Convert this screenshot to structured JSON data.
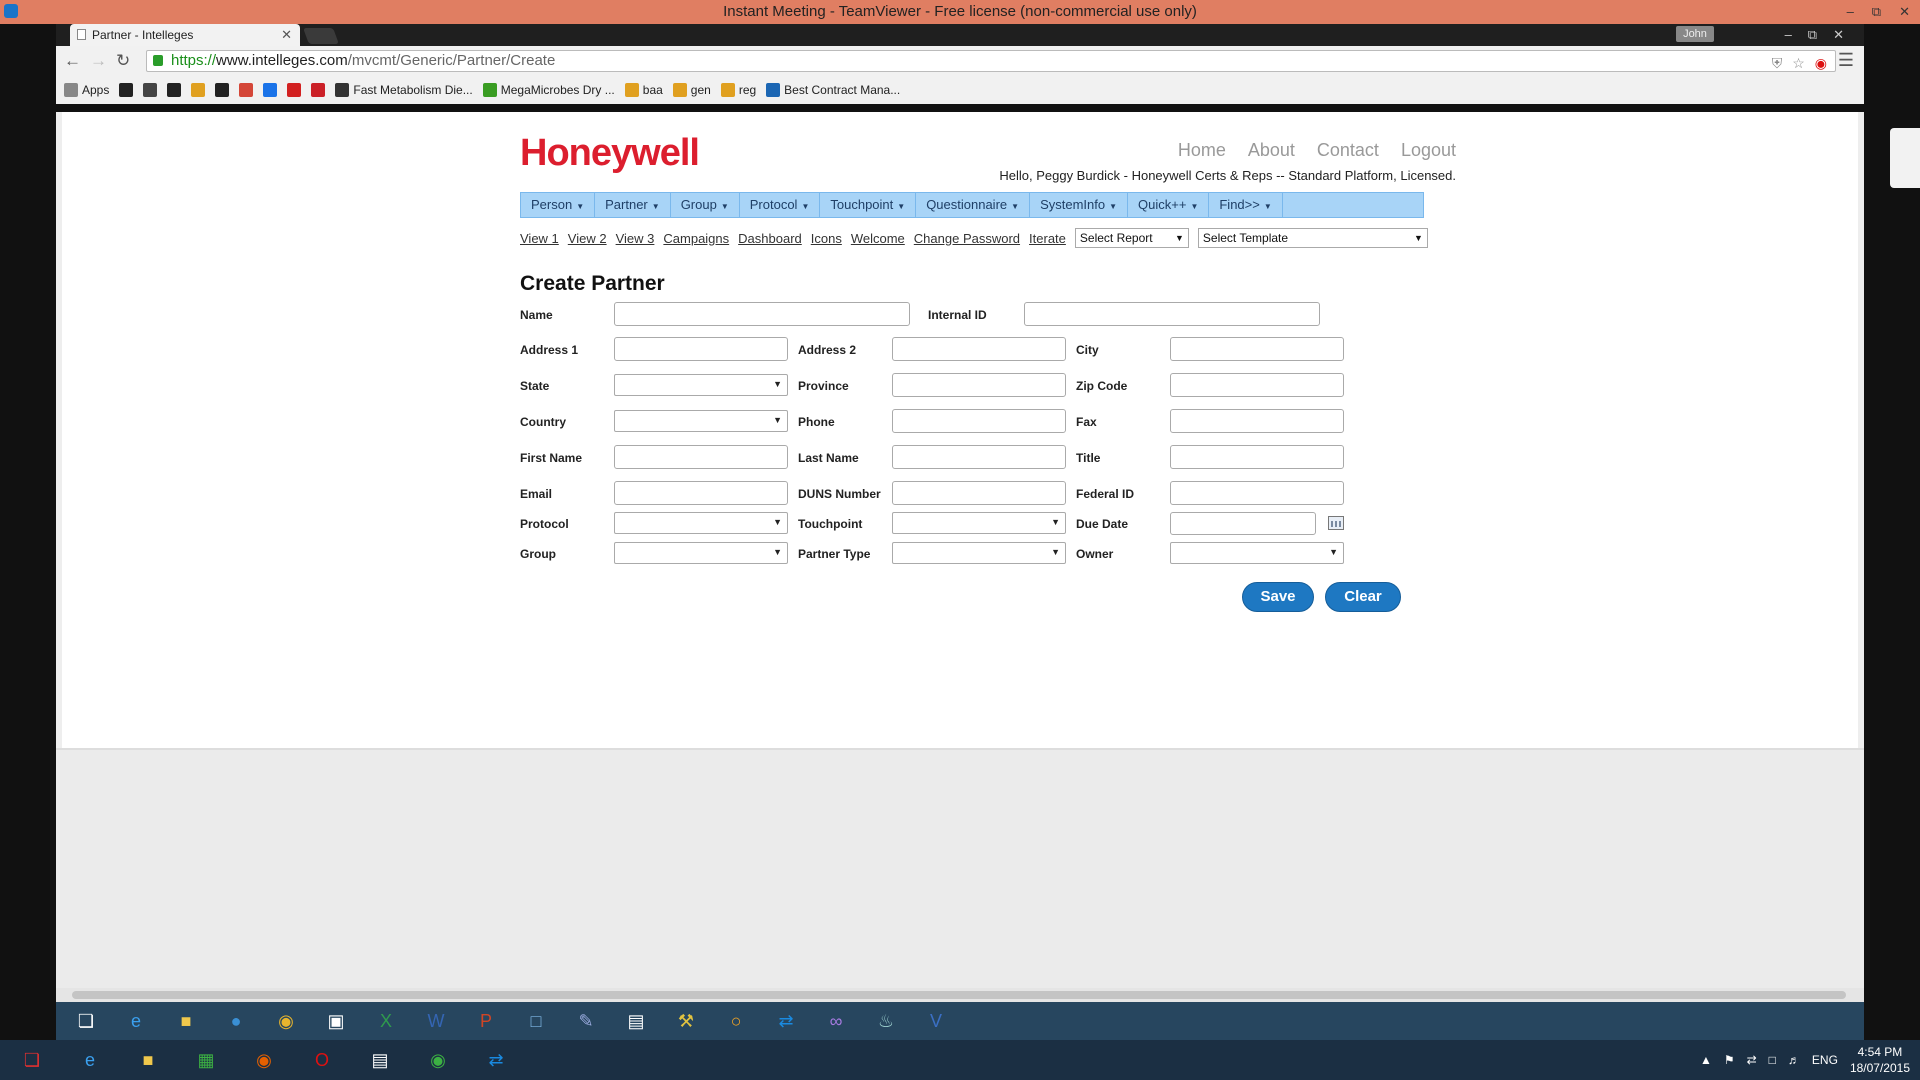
{
  "teamviewer": {
    "title": "Instant Meeting - TeamViewer - Free license (non-commercial use only)"
  },
  "browser": {
    "tab_title": "Partner - Intelleges",
    "profile": "John",
    "url_scheme": "https://",
    "url_host": "www.intelleges.com",
    "url_path": "/mvcmt/Generic/Partner/Create",
    "bookmarks": [
      {
        "label": "Apps",
        "icon": "apps-icon",
        "color": "#888888"
      },
      {
        "label": "",
        "icon": "nyt-icon",
        "color": "#222222"
      },
      {
        "label": "",
        "icon": "h-icon",
        "color": "#444444"
      },
      {
        "label": "",
        "icon": "wp-icon",
        "color": "#222222"
      },
      {
        "label": "",
        "icon": "bookmark-cluster-icon",
        "color": "#e0a020"
      },
      {
        "label": "",
        "icon": "amazon-icon",
        "color": "#222222"
      },
      {
        "label": "",
        "icon": "gmail-icon",
        "color": "#d44638"
      },
      {
        "label": "",
        "icon": "play-icon",
        "color": "#1a73e8"
      },
      {
        "label": "",
        "icon": "on-icon",
        "color": "#d22020"
      },
      {
        "label": "",
        "icon": "pinterest-icon",
        "color": "#cb2027"
      },
      {
        "label": "Fast Metabolism Die...",
        "icon": "leaf-icon",
        "color": "#333333"
      },
      {
        "label": "MegaMicrobes Dry ...",
        "icon": "f-icon",
        "color": "#3a9d23"
      },
      {
        "label": "baa",
        "icon": "bookmark-cluster-icon",
        "color": "#e0a020"
      },
      {
        "label": "gen",
        "icon": "bookmark-cluster-icon",
        "color": "#e0a020"
      },
      {
        "label": "reg",
        "icon": "bookmark-cluster-icon",
        "color": "#e0a020"
      },
      {
        "label": "Best Contract Mana...",
        "icon": "c-icon",
        "color": "#1b66b3"
      }
    ]
  },
  "site": {
    "logo": "Honeywell",
    "topnav": [
      "Home",
      "About",
      "Contact",
      "Logout"
    ],
    "greeting": "Hello, Peggy Burdick - Honeywell Certs & Reps -- Standard Platform, Licensed.",
    "menu": [
      "Person",
      "Partner",
      "Group",
      "Protocol",
      "Touchpoint",
      "Questionnaire",
      "SystemInfo",
      "Quick++",
      "Find>>"
    ],
    "subnav": [
      "View 1",
      "View 2",
      "View 3",
      "Campaigns",
      "Dashboard",
      "Icons",
      "Welcome",
      "Change Password",
      "Iterate"
    ],
    "select_report": "Select Report",
    "select_template": "Select Template"
  },
  "form": {
    "title": "Create Partner",
    "labels": {
      "name": "Name",
      "internal_id": "Internal ID",
      "address1": "Address 1",
      "address2": "Address 2",
      "city": "City",
      "state": "State",
      "province": "Province",
      "zip": "Zip Code",
      "country": "Country",
      "phone": "Phone",
      "fax": "Fax",
      "first_name": "First Name",
      "last_name": "Last Name",
      "title": "Title",
      "email": "Email",
      "duns": "DUNS Number",
      "federal_id": "Federal ID",
      "protocol": "Protocol",
      "touchpoint": "Touchpoint",
      "due_date": "Due Date",
      "group": "Group",
      "partner_type": "Partner Type",
      "owner": "Owner"
    },
    "save": "Save",
    "clear": "Clear"
  },
  "tray": {
    "lang": "ENG",
    "time": "4:54 PM",
    "date": "18/07/2015"
  }
}
